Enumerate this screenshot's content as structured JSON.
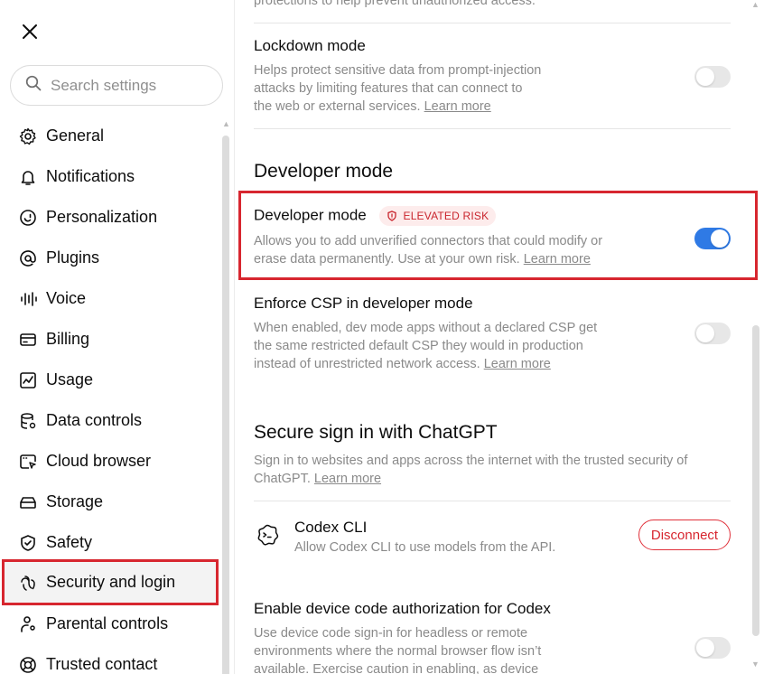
{
  "sidebar": {
    "search_placeholder": "Search settings",
    "items": [
      {
        "label": "General",
        "icon": "gear-icon"
      },
      {
        "label": "Notifications",
        "icon": "bell-icon"
      },
      {
        "label": "Personalization",
        "icon": "personalization-icon"
      },
      {
        "label": "Plugins",
        "icon": "at-icon"
      },
      {
        "label": "Voice",
        "icon": "voice-icon"
      },
      {
        "label": "Billing",
        "icon": "card-icon"
      },
      {
        "label": "Usage",
        "icon": "chart-icon"
      },
      {
        "label": "Data controls",
        "icon": "database-icon"
      },
      {
        "label": "Cloud browser",
        "icon": "browser-icon"
      },
      {
        "label": "Storage",
        "icon": "storage-icon"
      },
      {
        "label": "Safety",
        "icon": "shield-icon"
      },
      {
        "label": "Security and login",
        "icon": "security-icon",
        "active": true
      },
      {
        "label": "Parental controls",
        "icon": "parental-icon"
      },
      {
        "label": "Trusted contact",
        "icon": "lifebuoy-icon"
      }
    ]
  },
  "main": {
    "top_partial": "protections to help prevent unauthorized access.",
    "lockdown": {
      "title": "Lockdown mode",
      "desc": "Helps protect sensitive data from prompt-injection attacks by limiting features that can connect to the web or external services.",
      "link": "Learn more",
      "enabled": false
    },
    "developer_section": {
      "heading": "Developer mode",
      "dev_mode": {
        "title": "Developer mode",
        "badge": "ELEVATED RISK",
        "desc": "Allows you to add unverified connectors that could modify or erase data permanently. Use at your own risk.",
        "link": "Learn more",
        "enabled": true
      },
      "csp": {
        "title": "Enforce CSP in developer mode",
        "desc": "When enabled, dev mode apps without a declared CSP get the same restricted default CSP they would in production instead of unrestricted network access.",
        "link": "Learn more",
        "enabled": false
      }
    },
    "secure_signin": {
      "heading": "Secure sign in with ChatGPT",
      "desc": "Sign in to websites and apps across the internet with the trusted security of ChatGPT.",
      "link": "Learn more",
      "codex": {
        "title": "Codex CLI",
        "desc": "Allow Codex CLI to use models from the API.",
        "button": "Disconnect"
      },
      "device_code": {
        "title": "Enable device code authorization for Codex",
        "desc": "Use device code sign-in for headless or remote environments where the normal browser flow isn’t available. Exercise caution in enabling, as device",
        "enabled": false
      }
    }
  },
  "colors": {
    "accent": "#2f7ae5",
    "danger": "#d7262f",
    "muted_text": "#8a8a8a"
  }
}
